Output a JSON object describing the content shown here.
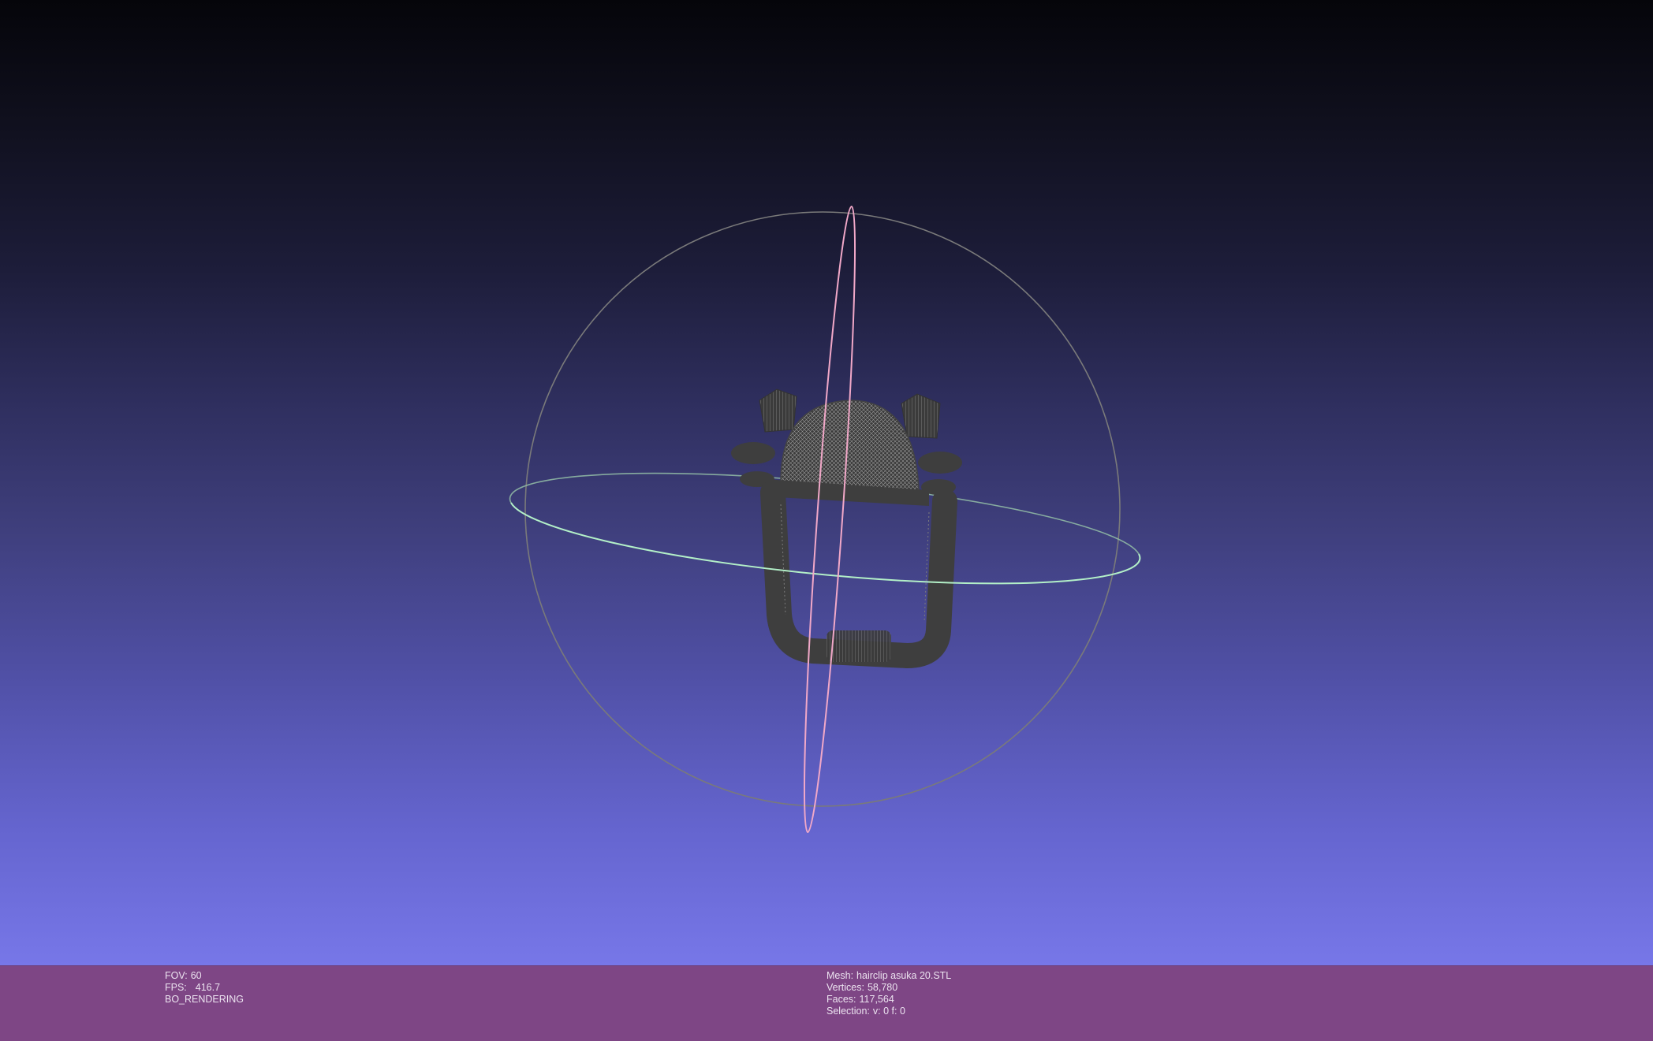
{
  "viewer": {
    "colors": {
      "mesh": "#3e3e3e",
      "mesh_highlight": "#a0a0a0",
      "trackball_sphere": "#7a7a7a",
      "trackball_horizontal": "#b3f0c8",
      "trackball_vertical": "#f1a8c8",
      "infobar_bg": "#7e4685"
    }
  },
  "status_left": {
    "fov_label": "FOV:",
    "fov_value": "60",
    "fps_label": "FPS:",
    "fps_value": "416.7",
    "render_mode": "BO_RENDERING"
  },
  "status_right": {
    "mesh_label": "Mesh:",
    "mesh_name": "hairclip asuka 20.STL",
    "vertices_label": "Vertices:",
    "vertices_value": "58,780",
    "faces_label": "Faces:",
    "faces_value": "117,564",
    "selection_label": "Selection:",
    "selection_value": "v: 0 f: 0"
  }
}
